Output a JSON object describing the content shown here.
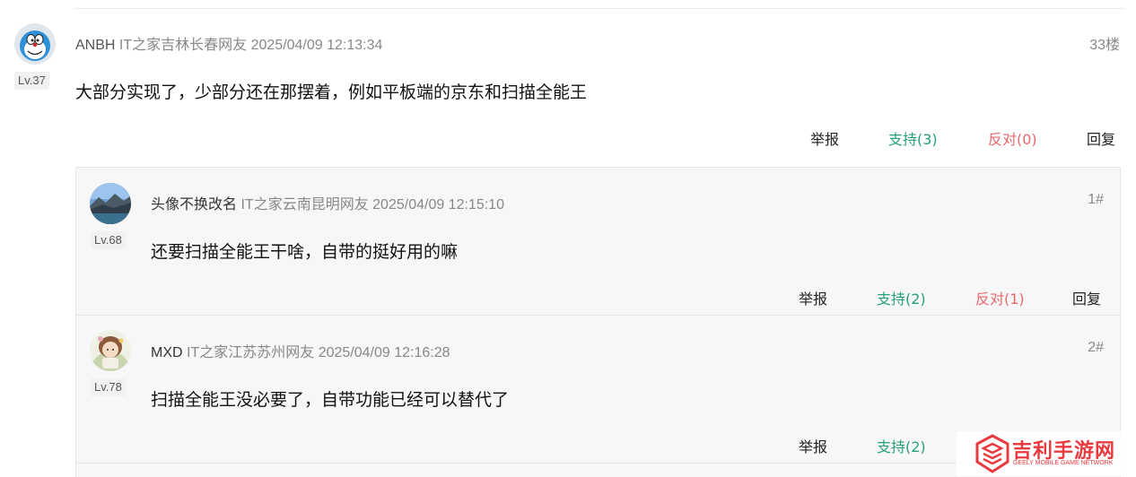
{
  "main_comment": {
    "username": "ANBH",
    "location": "IT之家吉林长春网友",
    "timestamp": "2025/04/09 12:13:34",
    "floor": "33楼",
    "level": "Lv.37",
    "content": "大部分实现了，少部分还在那摆着，例如平板端的京东和扫描全能王",
    "actions": {
      "report": "举报",
      "support": "支持(3)",
      "oppose": "反对(0)",
      "reply": "回复"
    }
  },
  "replies": [
    {
      "username": "头像不换改名",
      "location": "IT之家云南昆明网友",
      "timestamp": "2025/04/09 12:15:10",
      "floor": "1#",
      "level": "Lv.68",
      "content": "还要扫描全能王干啥，自带的挺好用的嘛",
      "actions": {
        "report": "举报",
        "support": "支持(2)",
        "oppose": "反对(1)",
        "reply": "回复"
      }
    },
    {
      "username": "MXD",
      "location": "IT之家江苏苏州网友",
      "timestamp": "2025/04/09 12:16:28",
      "floor": "2#",
      "level": "Lv.78",
      "content": "扫描全能王没必要了，自带功能已经可以替代了",
      "actions": {
        "report": "举报",
        "support": "支持(2)"
      }
    }
  ],
  "watermark": {
    "title": "吉利手游网",
    "subtitle": "GEELY MOBILE GAME NETWORK"
  },
  "colors": {
    "support": "#25a07a",
    "oppose": "#e8676b",
    "brand": "#e83a3f"
  }
}
